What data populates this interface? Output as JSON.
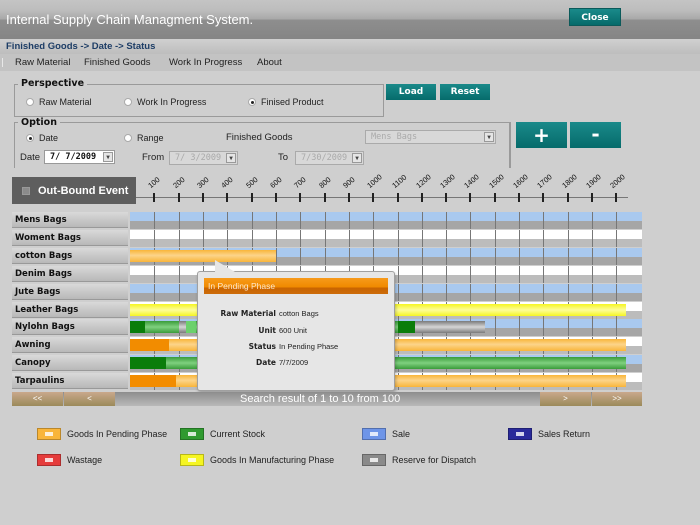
{
  "app": {
    "title": "Internal Supply Chain Managment System.",
    "close_label": "Close"
  },
  "breadcrumb": "Finished Goods -> Date -> Status",
  "menu": [
    "Raw Material",
    "Finished Goods",
    "Work In Progress",
    "About"
  ],
  "perspective": {
    "legend": "Perspective",
    "options": [
      {
        "label": "Raw Material",
        "selected": false
      },
      {
        "label": "Work In Progress",
        "selected": false
      },
      {
        "label": "Finised Product",
        "selected": true
      }
    ]
  },
  "buttons": {
    "load": "Load",
    "reset": "Reset",
    "zoom_in": "+",
    "zoom_out": "-"
  },
  "option": {
    "legend": "Option",
    "date_radio": "Date",
    "range_radio": "Range",
    "selected": "Date",
    "date_label": "Date",
    "date_value": "7/ 7/2009",
    "from_label": "From",
    "from_value": "7/ 3/2009",
    "to_label": "To",
    "to_value": "7/30/2009",
    "goods_label": "Finished Goods",
    "goods_value": "Mens Bags"
  },
  "outbound": {
    "label": "Out-Bound Event",
    "checked": false
  },
  "axis_ticks": [
    "100",
    "200",
    "300",
    "400",
    "500",
    "600",
    "700",
    "800",
    "900",
    "1000",
    "1100",
    "1200",
    "1300",
    "1400",
    "1500",
    "1600",
    "1700",
    "1800",
    "1900",
    "2000"
  ],
  "colors": {
    "pending": "#f9b53a",
    "pending_dark": "#f28c00",
    "stock": "#3a9c3a",
    "stock_dark": "#0a7d0a",
    "stock_light": "#6cd16c",
    "sale": "#6e95e8",
    "sales_return": "#2a2a9a",
    "wastage": "#e53c3c",
    "manufacturing": "#f5f522",
    "reserve": "#8a8a8a",
    "accent": "#0b7575"
  },
  "rows": [
    {
      "label": "Mens Bags",
      "track": "blue",
      "segments": []
    },
    {
      "label": "Woment Bags",
      "track": "white",
      "segments": []
    },
    {
      "label": "cotton Bags",
      "track": "blue",
      "segments": [
        {
          "from": 0,
          "to": 600,
          "type": "pending"
        }
      ]
    },
    {
      "label": "Denim Bags",
      "track": "white",
      "segments": []
    },
    {
      "label": "Jute Bags",
      "track": "blue",
      "segments": []
    },
    {
      "label": "Leather Bags",
      "track": "white",
      "segments": [
        {
          "from": 0,
          "to": 2040,
          "type": "manufacturing"
        }
      ]
    },
    {
      "label": "Nylohn Bags",
      "track": "blue",
      "segments": [
        {
          "from": 0,
          "to": 60,
          "type": "stock_dark"
        },
        {
          "from": 60,
          "to": 200,
          "type": "stock"
        },
        {
          "from": 200,
          "to": 230,
          "type": "reserve"
        },
        {
          "from": 230,
          "to": 270,
          "type": "stock_light"
        },
        {
          "from": 270,
          "to": 1100,
          "type": "stock"
        },
        {
          "from": 1100,
          "to": 1170,
          "type": "stock_dark"
        },
        {
          "from": 1170,
          "to": 1460,
          "type": "reserve"
        }
      ]
    },
    {
      "label": "Awning",
      "track": "white",
      "segments": [
        {
          "from": 0,
          "to": 160,
          "type": "pending_dark"
        },
        {
          "from": 160,
          "to": 2040,
          "type": "pending"
        }
      ]
    },
    {
      "label": "Canopy",
      "track": "blue",
      "segments": [
        {
          "from": 0,
          "to": 150,
          "type": "stock_dark"
        },
        {
          "from": 150,
          "to": 2040,
          "type": "stock"
        }
      ]
    },
    {
      "label": "Tarpaulins",
      "track": "white",
      "segments": [
        {
          "from": 0,
          "to": 190,
          "type": "pending_dark"
        },
        {
          "from": 190,
          "to": 2040,
          "type": "pending"
        }
      ]
    }
  ],
  "tooltip": {
    "header": "In Pending Phase",
    "fields": [
      {
        "key": "Raw Material",
        "value": "cotton Bags"
      },
      {
        "key": "Unit",
        "value": "600 Unit"
      },
      {
        "key": "Status",
        "value": "In Pending Phase"
      },
      {
        "key": "Date",
        "value": "7/7/2009"
      }
    ]
  },
  "pager": {
    "first": "<<",
    "prev": "<",
    "next": ">",
    "last": ">>",
    "text": "Search result of 1 to 10 from 100"
  },
  "legend": [
    {
      "label": "Goods In Pending Phase",
      "color": "#f9b53a"
    },
    {
      "label": "Current Stock",
      "color": "#2f9a2f"
    },
    {
      "label": "Sale",
      "color": "#6e95e8"
    },
    {
      "label": "Sales Return",
      "color": "#2a2a9a"
    },
    {
      "label": "Wastage",
      "color": "#e53c3c"
    },
    {
      "label": "Goods In Manufacturing Phase",
      "color": "#f5f522"
    },
    {
      "label": "Reserve for Dispatch",
      "color": "#8a8a8a"
    }
  ]
}
